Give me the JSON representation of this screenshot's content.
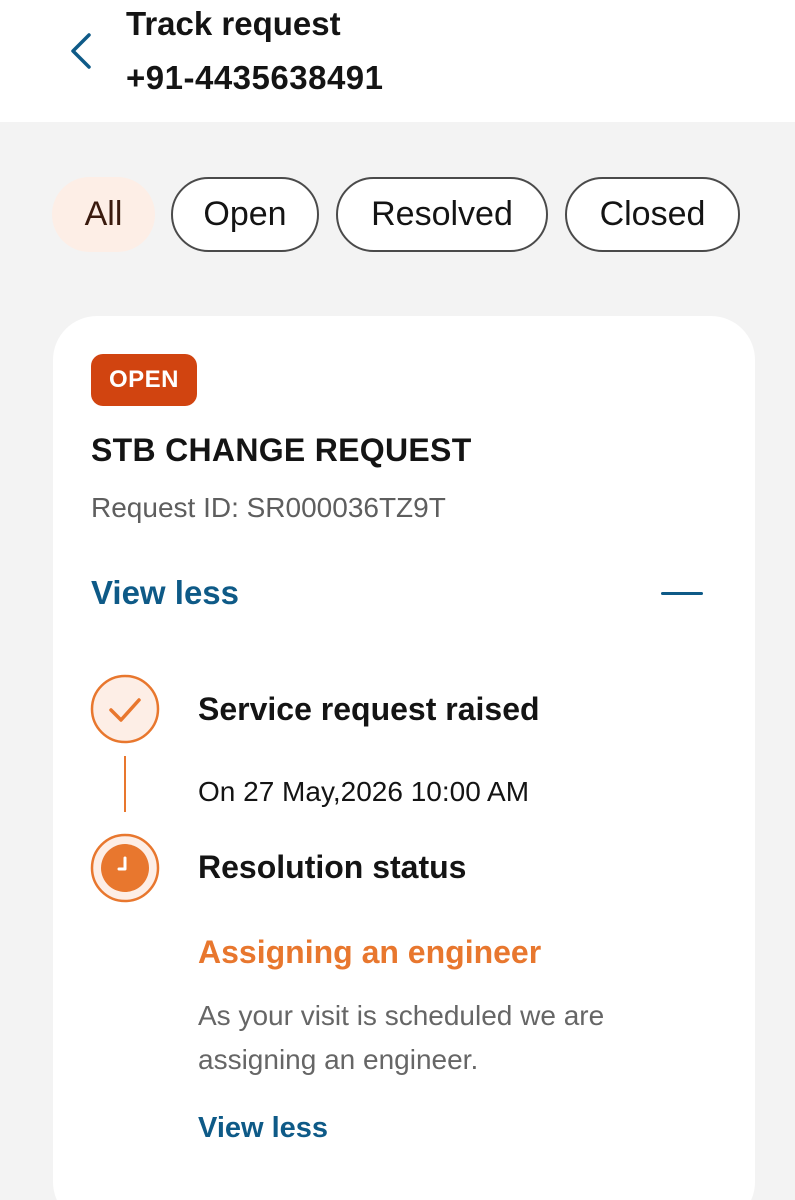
{
  "header": {
    "title": "Track request",
    "subtitle": "+91-4435638491",
    "back_icon": "chevron-left-icon"
  },
  "filters": {
    "items": [
      "All",
      "Open",
      "Resolved",
      "Closed"
    ],
    "selected": "All"
  },
  "request": {
    "status": "OPEN",
    "title": "STB CHANGE REQUEST",
    "request_id": "Request ID: SR000036TZ9T",
    "view_less": "View less",
    "collapse_icon": "minus-icon",
    "timeline": [
      {
        "title": "Service request raised",
        "date": "On 27 May,2026 10:00 AM",
        "icon": "check-circle-icon"
      },
      {
        "title": "Resolution status",
        "status": "Assigning an engineer",
        "description": "As your visit is scheduled we are assigning an engineer.",
        "link": "View less",
        "icon": "clock-circle-icon"
      }
    ]
  },
  "colors": {
    "accent_blue": "#0e5a87",
    "accent_orange": "#e8772e",
    "badge_open": "#d14410",
    "chip_active_bg": "#fdeee6",
    "page_bg": "#f3f3f3"
  }
}
